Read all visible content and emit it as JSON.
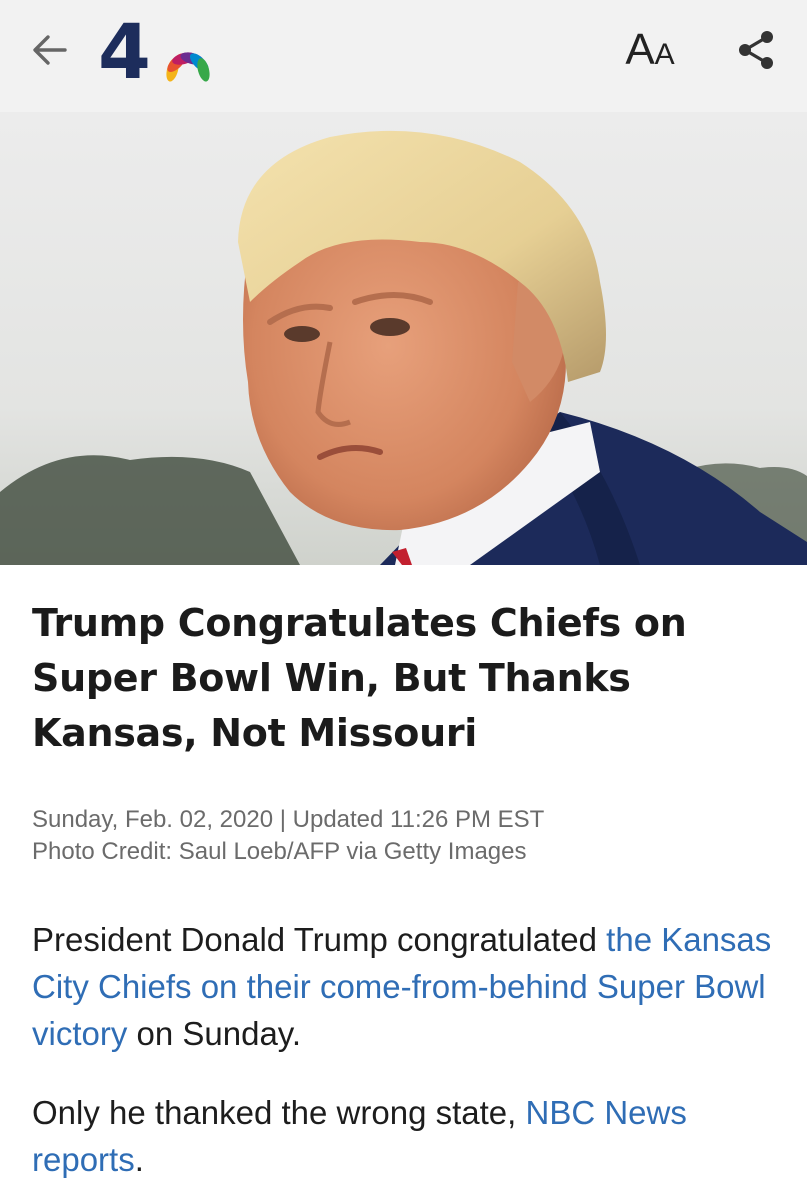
{
  "app": {
    "logo_text": "4",
    "back_icon": "arrow-left-icon",
    "share_icon": "share-icon",
    "font_size_label": {
      "big": "A",
      "small": "A"
    }
  },
  "colors": {
    "topbar_bg": "#f2f2f2",
    "logo_navy": "#1d2d5c",
    "link": "#2f6db5",
    "headline": "#1b1b1b",
    "meta": "#6b6b6b"
  },
  "article": {
    "headline": "Trump Congratulates Chiefs on Super Bowl Win, But Thanks Kansas, Not Missouri",
    "dateline": "Sunday, Feb. 02, 2020 | Updated 11:26 PM EST",
    "photo_credit": "Photo Credit: Saul Loeb/AFP via Getty Images",
    "p1": {
      "before": "President Donald Trump congratulated ",
      "link": "the Kansas City Chiefs on their come-from-behind Super Bowl victory",
      "after": " on Sunday."
    },
    "p2": {
      "before": "Only he thanked the wrong state, ",
      "link": "NBC News reports",
      "after": "."
    }
  }
}
